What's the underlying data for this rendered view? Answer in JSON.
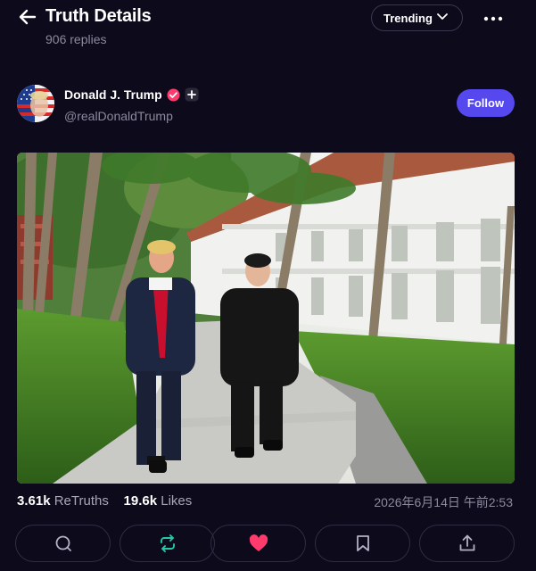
{
  "header": {
    "title": "Truth Details",
    "replies": "906 replies",
    "sort_label": "Trending"
  },
  "author": {
    "name": "Donald J. Trump",
    "handle": "@realDonaldTrump",
    "follow_label": "Follow"
  },
  "stats": {
    "retruths_count": "3.61k",
    "retruths_label": "ReTruths",
    "likes_count": "19.6k",
    "likes_label": "Likes",
    "timestamp": "2026年6月14日 午前2:53"
  },
  "colors": {
    "background": "#0d0a1c",
    "accent": "#5448ee",
    "like": "#ff3b6e",
    "retruth": "#26c6a8",
    "verified": "#ff3b6e"
  },
  "icons": [
    "back-arrow-icon",
    "chevron-down-icon",
    "more-icon",
    "verified-icon",
    "plus-icon",
    "comment-icon",
    "retruth-icon",
    "heart-icon",
    "bookmark-icon",
    "share-icon"
  ]
}
